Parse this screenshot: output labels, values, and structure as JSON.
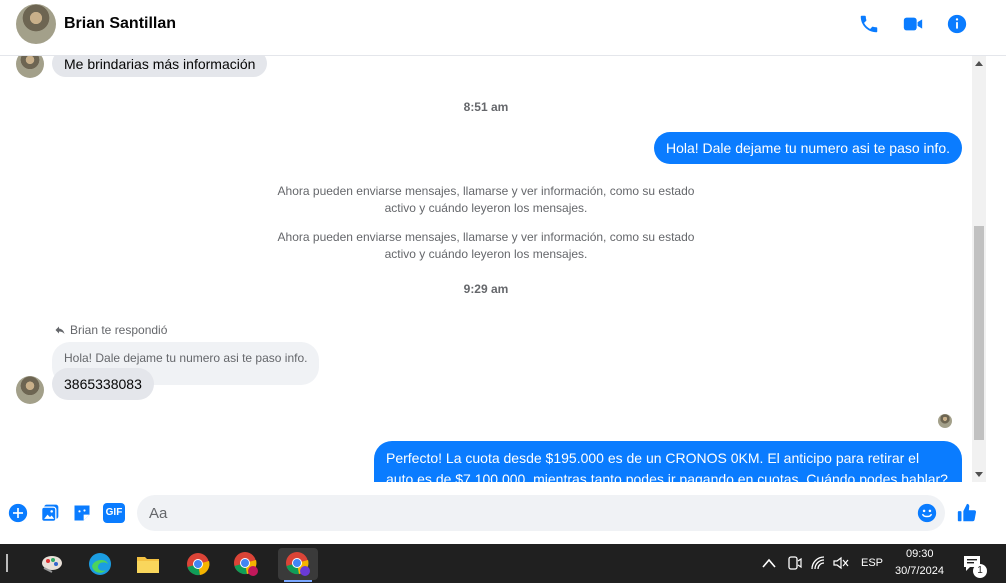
{
  "header": {
    "contact_name": "Brian Santillan"
  },
  "messages": {
    "m1": "Me brindarias más información",
    "time1": "8:51 am",
    "m2": "Hola! Dale dejame tu numero  asi te paso info.",
    "sys1": "Ahora pueden enviarse mensajes, llamarse y ver información, como su estado activo y cuándo leyeron los mensajes.",
    "sys2": "Ahora pueden enviarse mensajes, llamarse y ver información, como su estado activo y cuándo leyeron los mensajes.",
    "time2": "9:29 am",
    "reply_label": "Brian te respondió",
    "quoted": "Hola! Dale dejame tu numero  asi te paso info.",
    "m3": "3865338083",
    "m4": "Perfecto! La cuota desde $195.000 es de un CRONOS 0KM. El anticipo para retirar el auto es de $7.100.000, mientras tanto podes ir pagando en cuotas. Cuándo podes hablar? A la"
  },
  "composer": {
    "placeholder": "Aa",
    "gif_label": "GIF"
  },
  "taskbar": {
    "language": "ESP",
    "time": "09:30",
    "date": "30/7/2024",
    "notification_count": "1"
  },
  "colors": {
    "accent": "#0a7cff",
    "bubble_in": "#e4e6eb",
    "taskbar": "#202020"
  }
}
